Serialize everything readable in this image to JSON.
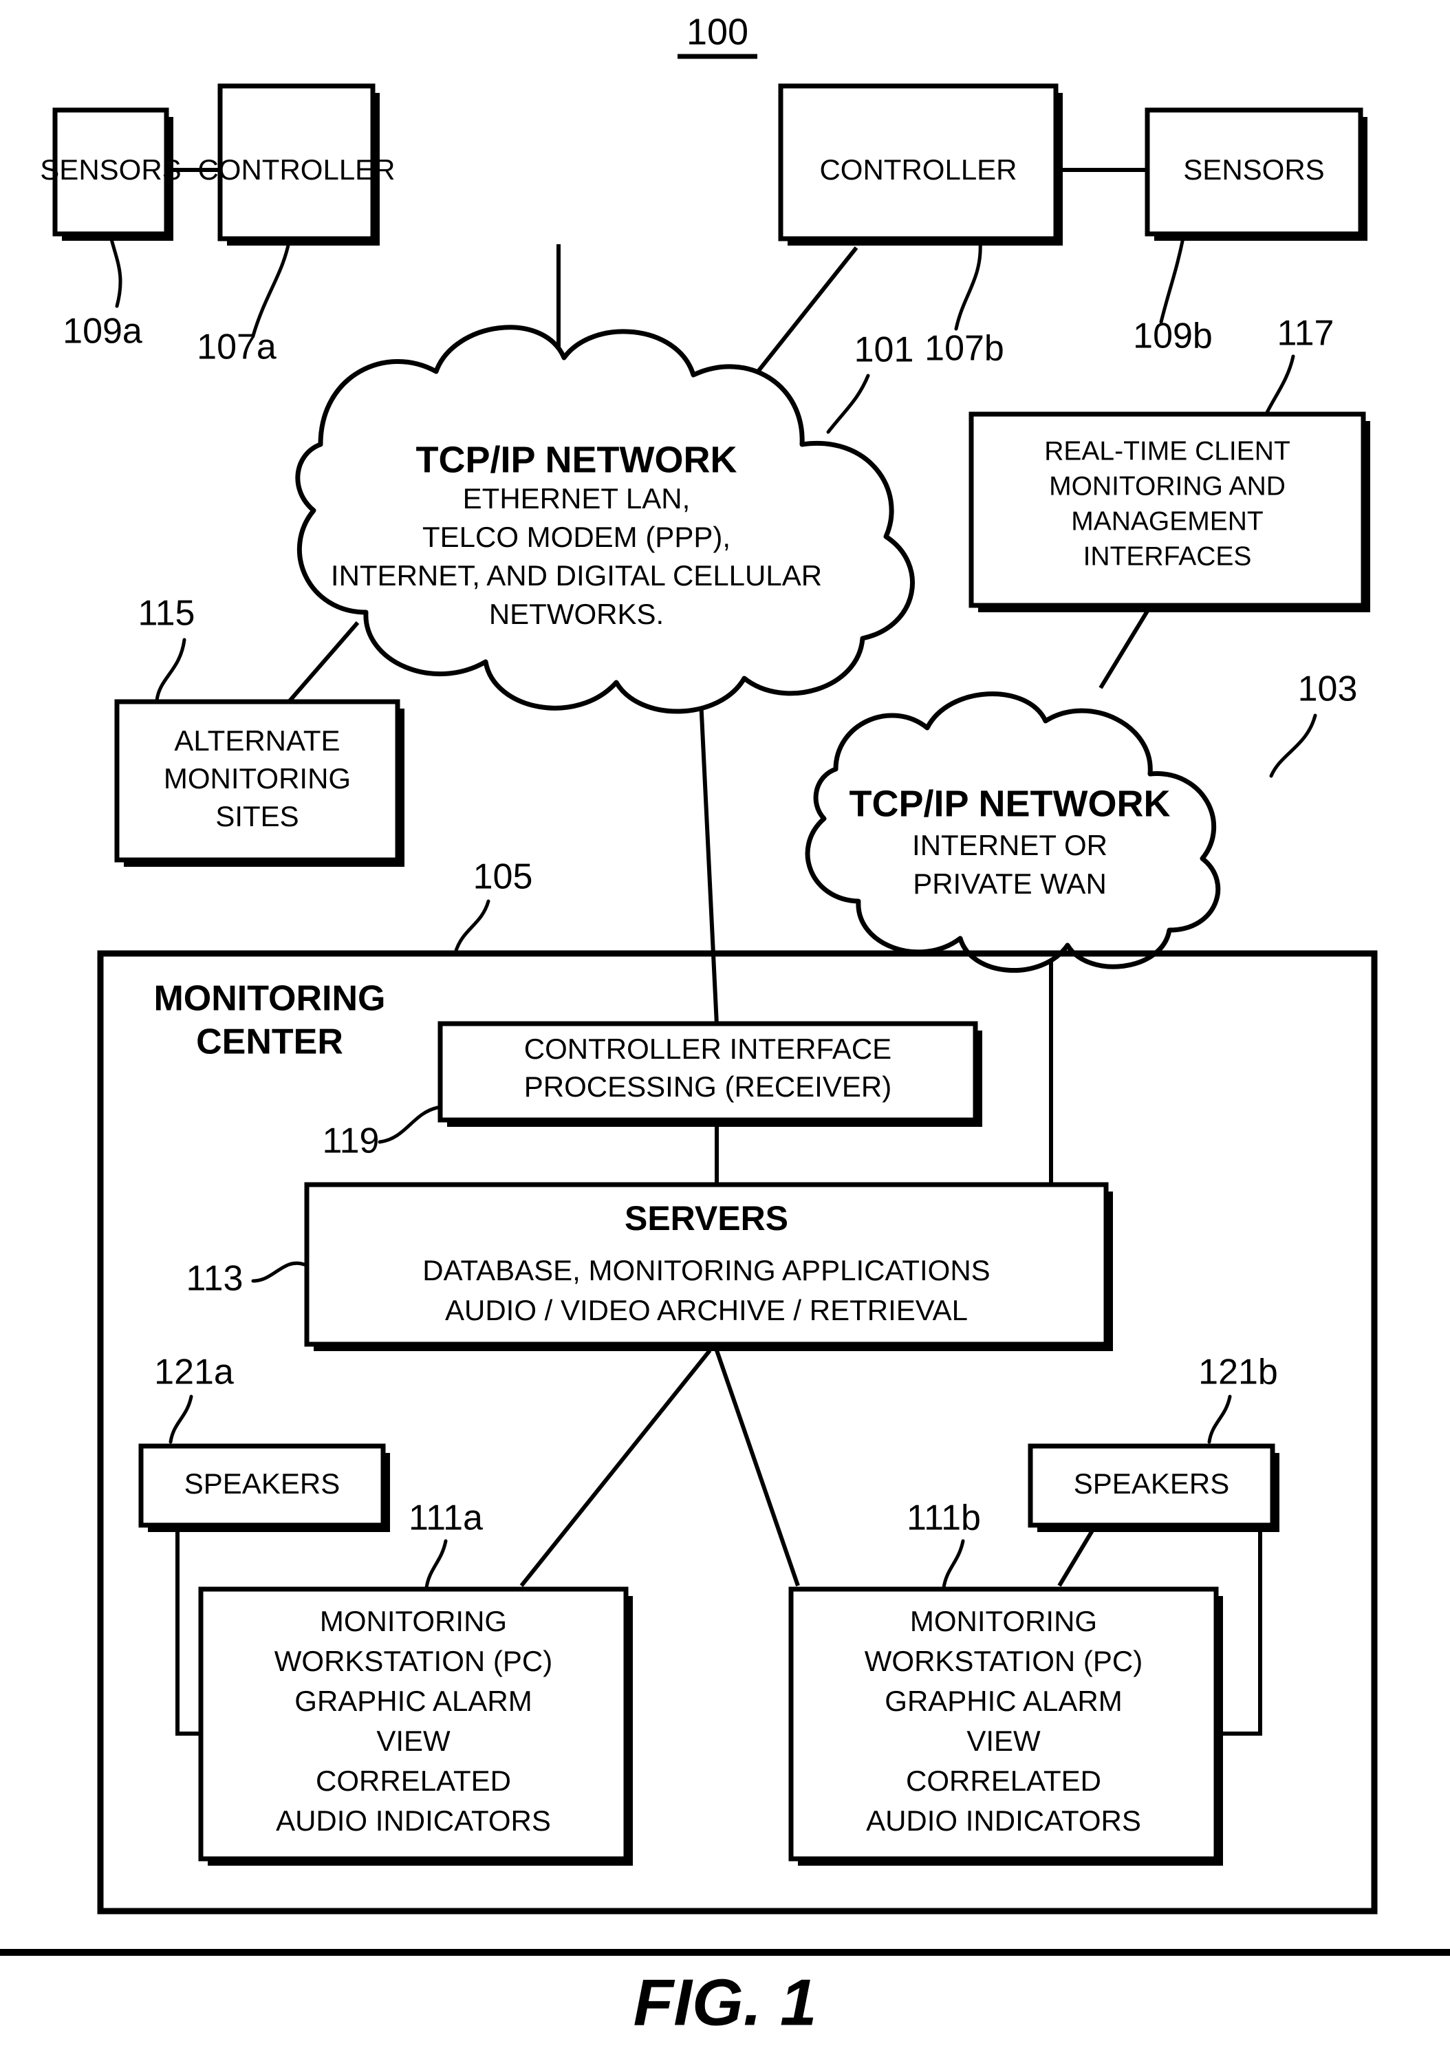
{
  "figure": {
    "number_label": "100",
    "caption": "FIG. 1"
  },
  "nodes": {
    "sensors_left": {
      "label": "SENSORS",
      "ref": "109a"
    },
    "controller_left": {
      "label": "CONTROLLER",
      "ref": "107a"
    },
    "controller_right": {
      "label": "CONTROLLER",
      "ref": "107b"
    },
    "sensors_right": {
      "label": "SENSORS",
      "ref": "109b"
    },
    "network_main": {
      "ref": "101",
      "title": "TCP/IP NETWORK",
      "lines": [
        "ETHERNET LAN,",
        "TELCO MODEM (PPP),",
        "INTERNET, AND DIGITAL CELLULAR",
        "NETWORKS."
      ]
    },
    "network_wan": {
      "ref": "103",
      "title": "TCP/IP NETWORK",
      "lines": [
        "INTERNET OR",
        "PRIVATE WAN"
      ]
    },
    "client_interfaces": {
      "ref": "117",
      "lines": [
        "REAL-TIME CLIENT",
        "MONITORING AND",
        "MANAGEMENT",
        "INTERFACES"
      ]
    },
    "alternate_sites": {
      "ref": "115",
      "lines": [
        "ALTERNATE",
        "MONITORING",
        "SITES"
      ]
    },
    "monitoring_center": {
      "ref": "105",
      "title_lines": [
        "MONITORING",
        "CENTER"
      ]
    },
    "controller_interface": {
      "ref": "119",
      "lines": [
        "CONTROLLER INTERFACE",
        "PROCESSING (RECEIVER)"
      ]
    },
    "servers": {
      "ref": "113",
      "title": "SERVERS",
      "lines": [
        "DATABASE, MONITORING APPLICATIONS",
        "AUDIO / VIDEO ARCHIVE / RETRIEVAL"
      ]
    },
    "speakers_left": {
      "label": "SPEAKERS",
      "ref": "121a"
    },
    "speakers_right": {
      "label": "SPEAKERS",
      "ref": "121b"
    },
    "workstation_left": {
      "ref": "111a",
      "lines": [
        "MONITORING",
        "WORKSTATION (PC)",
        "GRAPHIC ALARM",
        "VIEW",
        "CORRELATED",
        "AUDIO INDICATORS"
      ]
    },
    "workstation_right": {
      "ref": "111b",
      "lines": [
        "MONITORING",
        "WORKSTATION (PC)",
        "GRAPHIC ALARM",
        "VIEW",
        "CORRELATED",
        "AUDIO INDICATORS"
      ]
    }
  },
  "colors": {
    "ink": "#000000",
    "paper": "#ffffff"
  }
}
